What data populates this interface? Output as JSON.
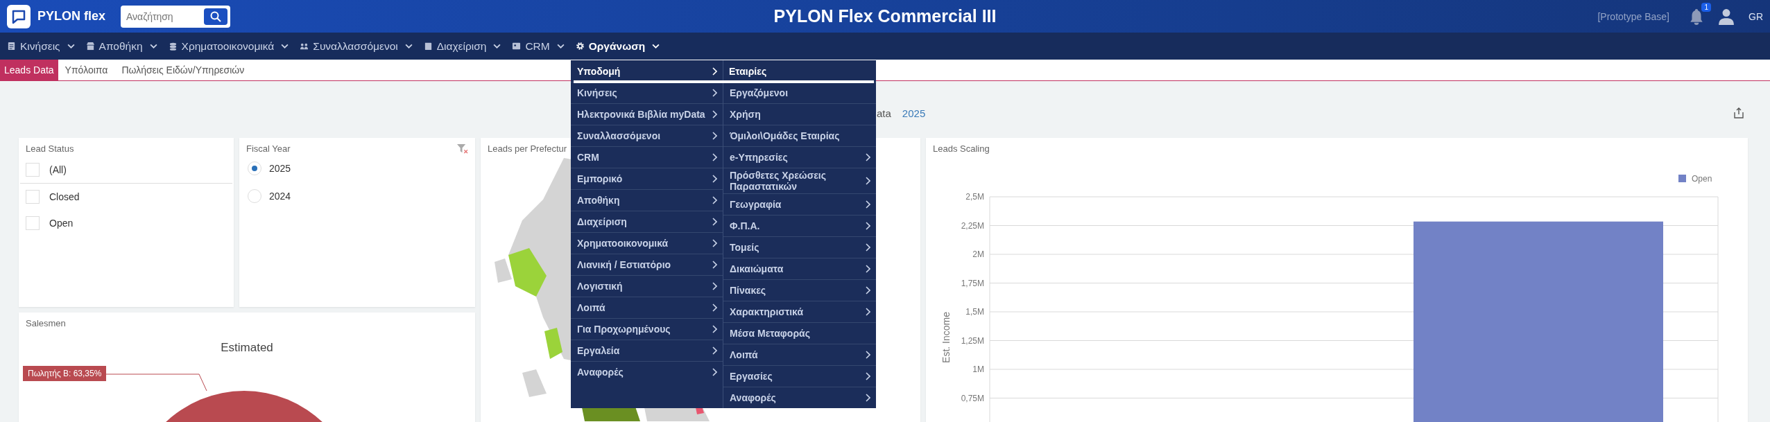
{
  "header": {
    "brand": "PYLON flex",
    "search": {
      "placeholder": "Αναζήτηση"
    },
    "title": "PYLON Flex Commercial III",
    "database": "[Prototype Base]",
    "notifications": "1",
    "language": "GR"
  },
  "nav": [
    {
      "label": "Κινήσεις",
      "kind": "doc",
      "open": false
    },
    {
      "label": "Αποθήκη",
      "kind": "store",
      "open": false
    },
    {
      "label": "Χρηματοοικονομικά",
      "kind": "coins",
      "open": false
    },
    {
      "label": "Συναλλασσόμενοι",
      "kind": "people",
      "open": false
    },
    {
      "label": "Διαχείριση",
      "kind": "book",
      "open": false
    },
    {
      "label": "CRM",
      "kind": "card",
      "open": false
    },
    {
      "label": "Οργάνωση",
      "kind": "gear",
      "open": true
    }
  ],
  "menu": {
    "items": [
      {
        "label": "Υποδομή",
        "selected": true
      },
      {
        "label": "Κινήσεις",
        "selected": false
      },
      {
        "label": "Ηλεκτρονικά Βιβλία myData",
        "selected": false
      },
      {
        "label": "Συναλλασσόμενοι",
        "selected": false
      },
      {
        "label": "CRM",
        "selected": false
      },
      {
        "label": "Εμπορικό",
        "selected": false
      },
      {
        "label": "Αποθήκη",
        "selected": false
      },
      {
        "label": "Διαχείριση",
        "selected": false
      },
      {
        "label": "Χρηματοοικονομικά",
        "selected": false
      },
      {
        "label": "Λιανική / Εστιατόριο",
        "selected": false
      },
      {
        "label": "Λογιστική",
        "selected": false
      },
      {
        "label": "Λοιπά",
        "selected": false
      },
      {
        "label": "Για Προχωρημένους",
        "selected": false
      },
      {
        "label": "Εργαλεία",
        "selected": false
      },
      {
        "label": "Αναφορές",
        "selected": false
      }
    ],
    "submenu": {
      "heading": "Εταιρίες",
      "items": [
        {
          "label": "Εργαζόμενοι",
          "has_submenu": false
        },
        {
          "label": "Χρήση",
          "has_submenu": false
        },
        {
          "label": "Όμιλοι\\Ομάδες Εταιρίας",
          "has_submenu": false
        },
        {
          "label": "e-Υπηρεσίες",
          "has_submenu": true
        },
        {
          "label": "Πρόσθετες Χρεώσεις Παραστατικών",
          "has_submenu": true
        },
        {
          "label": "Γεωγραφία",
          "has_submenu": true
        },
        {
          "label": "Φ.Π.Α.",
          "has_submenu": true
        },
        {
          "label": "Τομείς",
          "has_submenu": true
        },
        {
          "label": "Δικαιώματα",
          "has_submenu": true
        },
        {
          "label": "Πίνακες",
          "has_submenu": true
        },
        {
          "label": "Χαρακτηριστικά",
          "has_submenu": true
        },
        {
          "label": "Μέσα Μεταφοράς",
          "has_submenu": false
        },
        {
          "label": "Λοιπά",
          "has_submenu": true
        },
        {
          "label": "Εργασίες",
          "has_submenu": true
        },
        {
          "label": "Αναφορές",
          "has_submenu": true
        }
      ]
    }
  },
  "tabs": [
    {
      "label": "Leads Data",
      "selected": true
    },
    {
      "label": "Υπόλοιπα",
      "selected": false
    },
    {
      "label": "Πωλήσεις Ειδών/Υπηρεσιών",
      "selected": false
    }
  ],
  "dashboard": {
    "title": "ata",
    "year": "2025"
  },
  "lead_status": {
    "title": "Lead Status",
    "all": {
      "label": "(All)",
      "checked": false
    },
    "options": [
      {
        "label": "Closed",
        "checked": false
      },
      {
        "label": "Open",
        "checked": false
      }
    ]
  },
  "fiscal_year": {
    "title": "Fiscal Year",
    "options": [
      {
        "label": "2025",
        "selected": true
      },
      {
        "label": "2024",
        "selected": false
      }
    ]
  },
  "map": {
    "title": "Leads per Prefectur"
  },
  "salesmen": {
    "title": "Salesmen",
    "chart_title": "Estimated",
    "slice_label": "Πωλητής Β: 63,35%"
  },
  "leads_scaling": {
    "title": "Leads Scaling",
    "chart_data": {
      "type": "bar",
      "grid": true,
      "ylabel": "Est. Income",
      "ylim": [
        0,
        2500000
      ],
      "yticks": [
        {
          "value": 750000,
          "label": "0,75M"
        },
        {
          "value": 1000000,
          "label": "1M"
        },
        {
          "value": 1250000,
          "label": "1,25M"
        },
        {
          "value": 1500000,
          "label": "1,5M"
        },
        {
          "value": 1750000,
          "label": "1,75M"
        },
        {
          "value": 2000000,
          "label": "2M"
        },
        {
          "value": 2250000,
          "label": "2,25M"
        },
        {
          "value": 2500000,
          "label": "2,5M"
        }
      ],
      "series": [
        {
          "name": "Open",
          "color": "#7282c6",
          "values": [
            2285000
          ]
        }
      ]
    }
  }
}
